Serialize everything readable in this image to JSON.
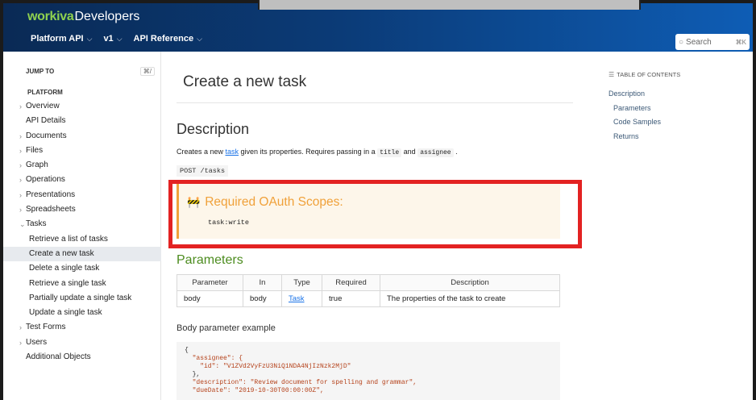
{
  "header": {
    "brand": "workiva",
    "brand_suffix": "Developers",
    "nav": [
      {
        "label": "Platform API",
        "chevron": "chevron-down-icon"
      },
      {
        "label": "v1",
        "chevron": "chevron-down-icon"
      },
      {
        "label": "API Reference",
        "chevron": "chevron-down-icon"
      }
    ],
    "search_placeholder": "Search",
    "search_shortcut": "⌘K",
    "colors": {
      "gradient_start": "#0a2a55",
      "gradient_end": "#0e5db5",
      "brand_green": "#8fd14f"
    }
  },
  "sidebar": {
    "jump_to": "JUMP TO",
    "jump_shortcut": "⌘/",
    "section": "PLATFORM",
    "items": [
      {
        "label": "Overview",
        "arrow": true
      },
      {
        "label": "API Details",
        "arrow": false
      },
      {
        "label": "Documents",
        "arrow": true
      },
      {
        "label": "Files",
        "arrow": true
      },
      {
        "label": "Graph",
        "arrow": true
      },
      {
        "label": "Operations",
        "arrow": true
      },
      {
        "label": "Presentations",
        "arrow": true
      },
      {
        "label": "Spreadsheets",
        "arrow": true
      },
      {
        "label": "Tasks",
        "arrow": true,
        "expanded": true
      },
      {
        "label": "Retrieve a list of tasks",
        "sub": true
      },
      {
        "label": "Create a new task",
        "sub": true,
        "active": true
      },
      {
        "label": "Delete a single task",
        "sub": true
      },
      {
        "label": "Retrieve a single task",
        "sub": true
      },
      {
        "label": "Partially update a single task",
        "sub": true
      },
      {
        "label": "Update a single task",
        "sub": true
      },
      {
        "label": "Test Forms",
        "arrow": true
      },
      {
        "label": "Users",
        "arrow": true
      },
      {
        "label": "Additional Objects",
        "arrow": false
      }
    ]
  },
  "main": {
    "title": "Create a new task",
    "description_heading": "Description",
    "description": {
      "pre": "Creates a new ",
      "link": "task",
      "mid": " given its properties. Requires passing in a ",
      "code1": "title",
      "and": " and ",
      "code2": "assignee",
      "end": " ."
    },
    "endpoint": "POST /tasks",
    "callout": {
      "icon": "roadblock-icon",
      "title": "Required OAuth Scopes:",
      "scope": "task:write",
      "accent": "#f0a13a",
      "highlight": "#e32222"
    },
    "parameters_heading": "Parameters",
    "params_table": {
      "headers": [
        "Parameter",
        "In",
        "Type",
        "Required",
        "Description"
      ],
      "rows": [
        [
          "body",
          "body",
          "Task",
          "true",
          "The properties of the task to create"
        ]
      ]
    },
    "body_example_heading": "Body parameter example",
    "code": [
      "{",
      "  \"assignee\": {",
      "    \"id\": \"V1ZVd2VyFzU3NiQ1NDA4NjIzNzk2MjD\"",
      "  },",
      "  \"description\": \"Review document for spelling and grammar\",",
      "  \"dueDate\": \"2019-10-30T00:00:00Z\","
    ]
  },
  "toc": {
    "heading": "TABLE OF CONTENTS",
    "items": [
      {
        "label": "Description",
        "sub": false
      },
      {
        "label": "Parameters",
        "sub": true
      },
      {
        "label": "Code Samples",
        "sub": true
      },
      {
        "label": "Returns",
        "sub": true
      }
    ]
  }
}
